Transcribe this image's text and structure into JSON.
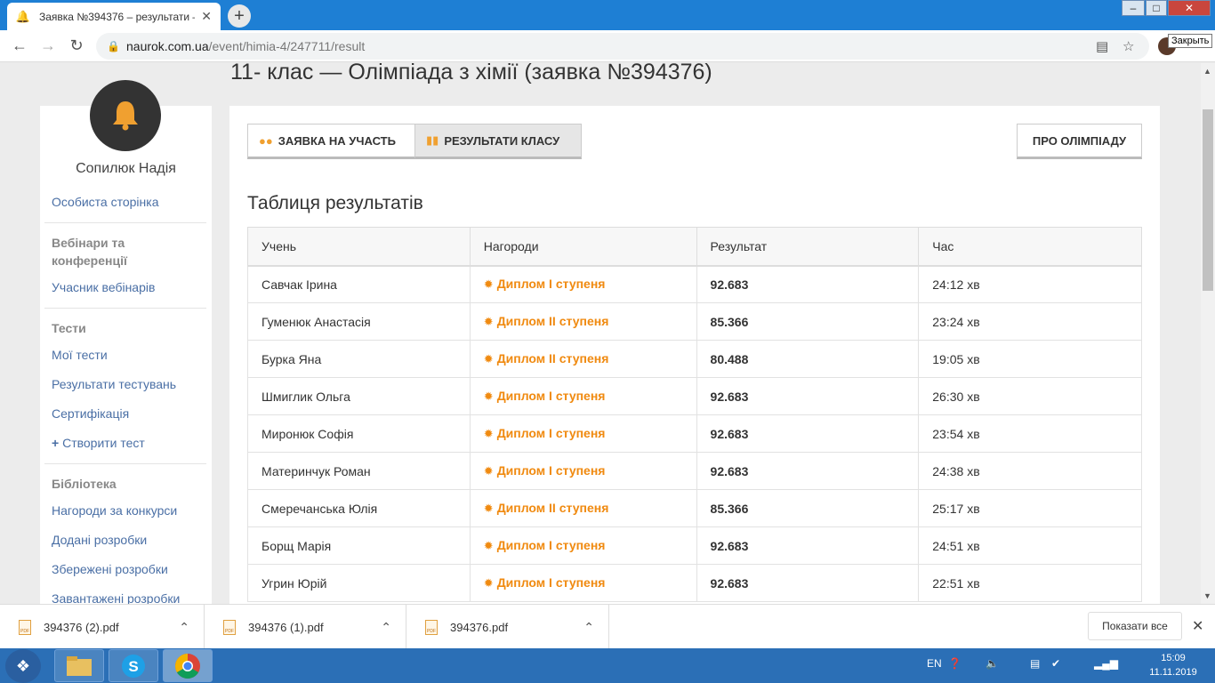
{
  "browser": {
    "tab_title": "Заявка №394376 – результати –",
    "url_host": "naurok.com.ua",
    "url_path": "/event/himia-4/247711/result",
    "tooltip": "Закрыть"
  },
  "page": {
    "title": "11- клас — Олімпіада з хімії (заявка №394376)"
  },
  "sidebar": {
    "user_name": "Сопилюк Надія",
    "personal_page": "Особиста сторінка",
    "webinars_heading": "Вебінари та конференції",
    "webinar_participant": "Учасник вебінарів",
    "tests_heading": "Тести",
    "my_tests": "Мої тести",
    "test_results": "Результати тестувань",
    "certification": "Сертифікація",
    "create_test": "Створити тест",
    "library_heading": "Бібліотека",
    "contest_awards": "Нагороди за конкурси",
    "added_materials": "Додані розробки",
    "saved_materials": "Збережені розробки",
    "downloaded_materials": "Завантажені розробки"
  },
  "main": {
    "apply_button": "ЗАЯВКА НА УЧАСТЬ",
    "results_button": "РЕЗУЛЬТАТИ КЛАСУ",
    "about_button": "ПРО ОЛІМПІАДУ",
    "table_title": "Таблиця результатів",
    "columns": [
      "Учень",
      "Нагороди",
      "Результат",
      "Час"
    ],
    "rows": [
      {
        "student": "Савчак Ірина",
        "award": "Диплом I ступеня",
        "result": "92.683",
        "time": "24:12 хв"
      },
      {
        "student": "Гуменюк Анастасія",
        "award": "Диплом II ступеня",
        "result": "85.366",
        "time": "23:24 хв"
      },
      {
        "student": "Бурка Яна",
        "award": "Диплом II ступеня",
        "result": "80.488",
        "time": "19:05 хв"
      },
      {
        "student": "Шмиглик Ольга",
        "award": "Диплом I ступеня",
        "result": "92.683",
        "time": "26:30 хв"
      },
      {
        "student": "Миронюк Софія",
        "award": "Диплом I ступеня",
        "result": "92.683",
        "time": "23:54 хв"
      },
      {
        "student": "Материнчук Роман",
        "award": "Диплом I ступеня",
        "result": "92.683",
        "time": "24:38 хв"
      },
      {
        "student": "Смеречанська Юлія",
        "award": "Диплом II ступеня",
        "result": "85.366",
        "time": "25:17 хв"
      },
      {
        "student": "Борщ Марія",
        "award": "Диплом I ступеня",
        "result": "92.683",
        "time": "24:51 хв"
      },
      {
        "student": "Угрин Юрій",
        "award": "Диплом I ступеня",
        "result": "92.683",
        "time": "22:51 хв"
      }
    ]
  },
  "downloads": {
    "files": [
      "394376 (2).pdf",
      "394376 (1).pdf",
      "394376.pdf"
    ],
    "show_all": "Показати все"
  },
  "taskbar": {
    "language": "EN",
    "time": "15:09",
    "date": "11.11.2019"
  },
  "colors": {
    "accent_orange": "#f08a10",
    "link_blue": "#4a6fa5",
    "taskbar_blue": "#2b6fb6"
  },
  "icons": [
    "bell-logo-icon",
    "group-icon",
    "bar-chart-icon",
    "sun-award-icon",
    "plus-icon",
    "lock-icon",
    "star-icon",
    "translate-icon",
    "pdf-file-icon",
    "chevron-up-icon",
    "close-icon"
  ]
}
